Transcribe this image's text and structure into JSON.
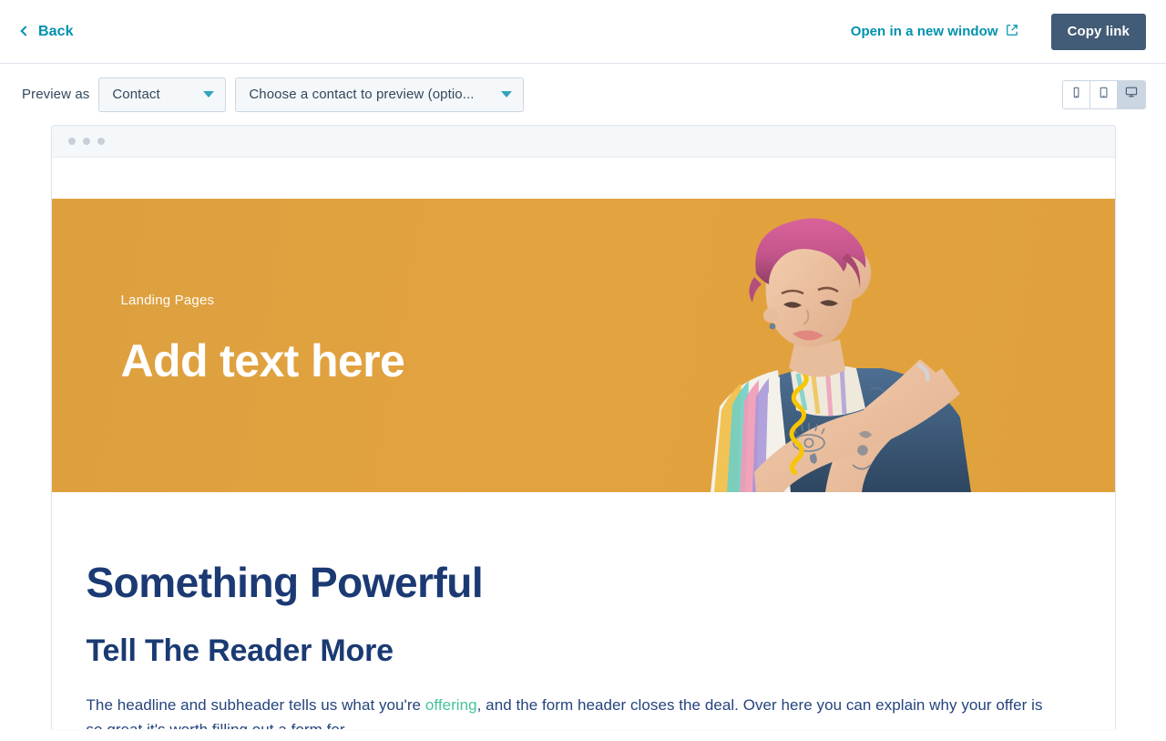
{
  "header": {
    "back_label": "Back",
    "back_icon": "chevron-left-icon",
    "open_new_window_label": "Open in a new window",
    "open_new_window_icon": "external-link-icon",
    "copy_link_label": "Copy link"
  },
  "toolbar": {
    "preview_as_label": "Preview as",
    "audience_select": {
      "value": "Contact",
      "caret_icon": "caret-down-icon"
    },
    "contact_select": {
      "value": "Choose a contact to preview (optio...",
      "placeholder": "Choose a contact to preview (optional)",
      "caret_icon": "caret-down-icon"
    },
    "devices": [
      {
        "name": "mobile",
        "icon": "mobile-phone-icon",
        "active": false
      },
      {
        "name": "tablet",
        "icon": "tablet-icon",
        "active": false
      },
      {
        "name": "desktop",
        "icon": "desktop-monitor-icon",
        "active": true
      }
    ]
  },
  "preview": {
    "window_dots": 3,
    "hero": {
      "eyebrow": "Landing Pages",
      "title": "Add text here",
      "background_color": "#e0a03c",
      "image_alt": "Person with pink hair holding a yellow telephone handset"
    },
    "content": {
      "heading": "Something Powerful",
      "subheading": "Tell The Reader More",
      "paragraph_part1": "The headline and subheader tells us what you're ",
      "paragraph_link": "offering",
      "paragraph_part2": ", and the form header closes the deal. Over here you can explain why your offer is so great it's worth filling out a form for.",
      "heading_color": "#1b3a73",
      "link_color": "#46c49c"
    }
  },
  "colors": {
    "link_teal": "#0091ae",
    "button_slate": "#425b76",
    "border": "#cbd6e2",
    "hero_amber": "#e0a03c"
  }
}
